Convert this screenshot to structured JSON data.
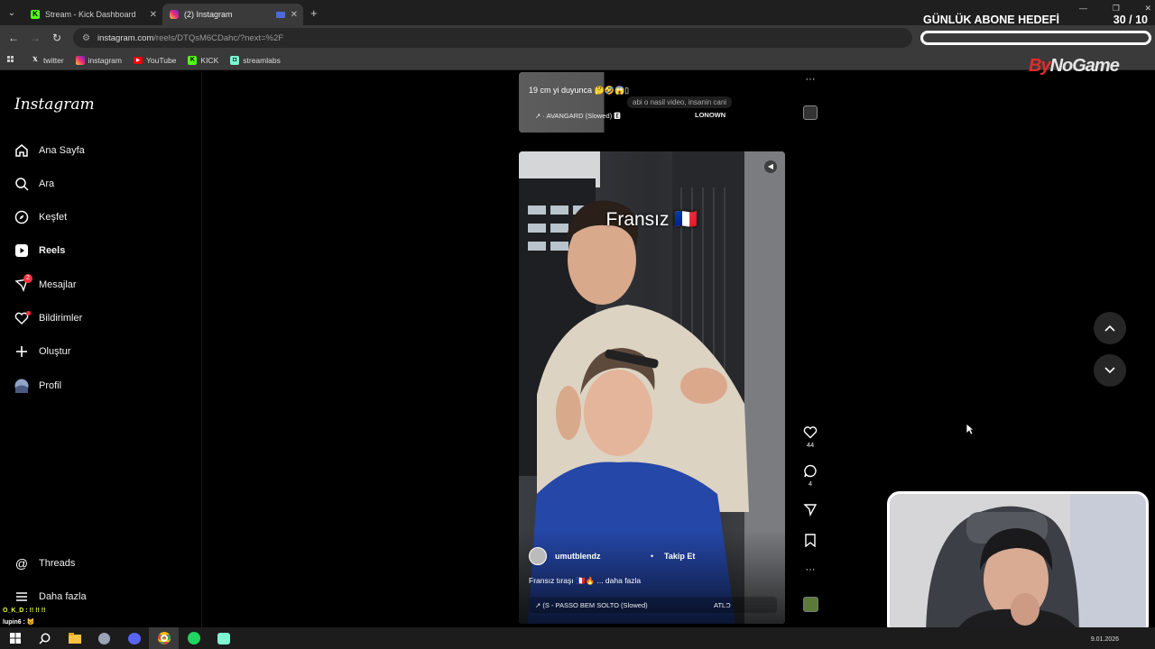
{
  "browser": {
    "tabs": [
      {
        "label": "Stream - Kick Dashboard",
        "icon": "kick-icon",
        "active": false
      },
      {
        "label": "(2) Instagram",
        "icon": "instagram-icon",
        "active": true
      }
    ],
    "url_main": "instagram.com",
    "url_rest": "/reels/DTQsM6CDahc/?next=%2F",
    "bookmarks": [
      {
        "label": "twitter",
        "icon": "x-icon"
      },
      {
        "label": "instagram",
        "icon": "instagram-icon"
      },
      {
        "label": "YouTube",
        "icon": "youtube-icon"
      },
      {
        "label": "KICK",
        "icon": "kick-icon"
      },
      {
        "label": "streamlabs",
        "icon": "streamlabs-icon"
      }
    ]
  },
  "instagram": {
    "logo": "Instagram",
    "nav": [
      {
        "label": "Ana Sayfa",
        "icon": "home-icon"
      },
      {
        "label": "Ara",
        "icon": "search-icon"
      },
      {
        "label": "Keşfet",
        "icon": "compass-icon"
      },
      {
        "label": "Reels",
        "icon": "reels-icon"
      },
      {
        "label": "Mesajlar",
        "icon": "messenger-icon",
        "badge": "2"
      },
      {
        "label": "Bildirimler",
        "icon": "heart-icon"
      },
      {
        "label": "Oluştur",
        "icon": "plus-icon"
      },
      {
        "label": "Profil",
        "icon": "avatar-icon"
      }
    ],
    "nav_bottom": [
      {
        "label": "Threads",
        "icon": "threads-icon"
      },
      {
        "label": "Daha fazla",
        "icon": "menu-icon"
      }
    ],
    "prev_reel": {
      "caption": "19 cm yi duyunca 🤔🤣😱▯",
      "overlay_text": "abi o nasil video, insanin cani",
      "music": "↗ · AVANGARD (Slowed) 🅴",
      "artist": "LONOWN"
    },
    "reel": {
      "overlay_title": "Fransız 🇫🇷",
      "username": "umutblendz",
      "follow_label": "Takip Et",
      "caption": "Fransız tıraşı 🇫🇷🔥 ... daha fazla",
      "music": "↗ (S - PASSO BEM SOLTO (Slowed)",
      "music_artist": "ATLϽ",
      "likes": "44",
      "comments": "4"
    }
  },
  "overlay": {
    "goal_title": "GÜNLÜK ABONE HEDEFİ",
    "goal_count": "30 / 10",
    "brand_a": "By",
    "brand_b": "NoGame",
    "chat": [
      "O_K_D : !! !! !!",
      "lupin6 : 🐱"
    ]
  },
  "taskbar": {
    "date": "9.01.2026"
  }
}
